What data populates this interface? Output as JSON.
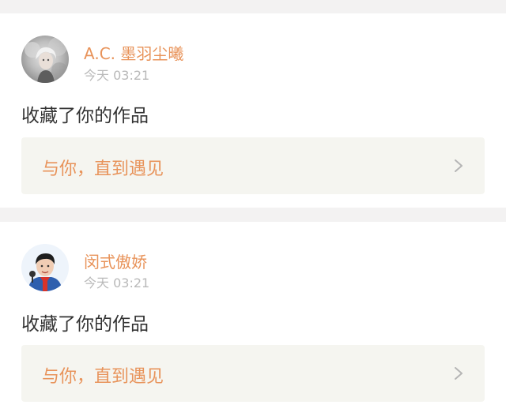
{
  "notifications": [
    {
      "username": "A.C. 墨羽尘曦",
      "time": "今天 03:21",
      "action": "收藏了你的作品",
      "work_title": "与你，直到遇见",
      "avatar_icon": "user-avatar-silver-hair"
    },
    {
      "username": "闵式傲娇",
      "time": "今天 03:21",
      "action": "收藏了你的作品",
      "work_title": "与你，直到遇见",
      "avatar_icon": "user-avatar-singer"
    }
  ],
  "colors": {
    "accent": "#e8935a",
    "timestamp": "#b9b9b9",
    "text": "#333333",
    "card_link_bg": "#f5f5f0",
    "page_bg": "#f3f2f2"
  }
}
